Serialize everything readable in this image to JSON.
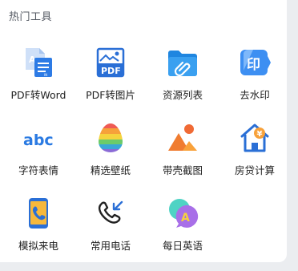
{
  "section": {
    "title": "热门工具"
  },
  "tools": [
    {
      "label": "PDF转Word",
      "icon": "pdf-to-word-icon"
    },
    {
      "label": "PDF转图片",
      "icon": "pdf-to-image-icon"
    },
    {
      "label": "资源列表",
      "icon": "resource-folder-icon"
    },
    {
      "label": "去水印",
      "icon": "remove-watermark-icon"
    },
    {
      "label": "字符表情",
      "icon": "abc-text-icon"
    },
    {
      "label": "精选壁纸",
      "icon": "rainbow-egg-icon"
    },
    {
      "label": "带壳截图",
      "icon": "mountain-sun-icon"
    },
    {
      "label": "房贷计算",
      "icon": "house-coin-icon"
    },
    {
      "label": "模拟来电",
      "icon": "phone-call-icon"
    },
    {
      "label": "常用电话",
      "icon": "incoming-call-icon"
    },
    {
      "label": "每日英语",
      "icon": "chat-letter-a-icon"
    }
  ]
}
